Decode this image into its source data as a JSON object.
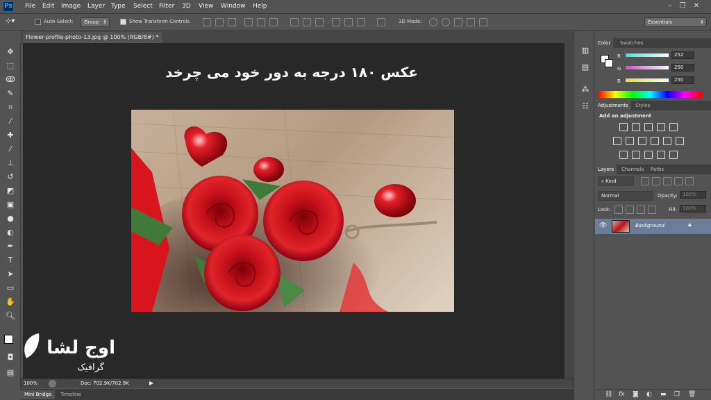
{
  "app": {
    "logo": "Ps"
  },
  "menu": [
    "File",
    "Edit",
    "Image",
    "Layer",
    "Type",
    "Select",
    "Filter",
    "3D",
    "View",
    "Window",
    "Help"
  ],
  "options": {
    "auto_select_label": "Auto-Select:",
    "auto_select_value": "Group",
    "show_transform_label": "Show Transform Controls",
    "mode_3d_label": "3D Mode:",
    "workspace": "Essentials"
  },
  "document": {
    "tab_title": "Flower-profile-photo-13.jpg @ 100% (RGB/8#) *",
    "canvas_title": "عکس ۱۸۰ درجه به دور خود می چرخد",
    "watermark_brand": "اوج لشا",
    "watermark_sub": "گرافیک"
  },
  "status": {
    "zoom": "100%",
    "doc": "Doc: 702.9K/702.9K"
  },
  "bottom_tabs": [
    "Mini Bridge",
    "Timeline"
  ],
  "color_panel": {
    "tabs": [
      "Color",
      "Swatches"
    ],
    "channels": [
      {
        "label": "R",
        "value": "252",
        "color": "#45e0e0"
      },
      {
        "label": "G",
        "value": "250",
        "color": "#e045e0"
      },
      {
        "label": "B",
        "value": "250",
        "color": "#e0e045"
      }
    ]
  },
  "adjustments_panel": {
    "tabs": [
      "Adjustments",
      "Styles"
    ],
    "heading": "Add an adjustment"
  },
  "layers_panel": {
    "tabs": [
      "Layers",
      "Channels",
      "Paths"
    ],
    "filter_label": "Kind",
    "blend_mode": "Normal",
    "opacity_label": "Opacity:",
    "opacity_value": "100%",
    "lock_label": "Lock:",
    "fill_label": "Fill:",
    "fill_value": "100%",
    "layer_name": "Background"
  },
  "colors": {
    "accent": "#31a8ff",
    "panel_bg": "#535353",
    "canvas_bg": "#282828"
  }
}
